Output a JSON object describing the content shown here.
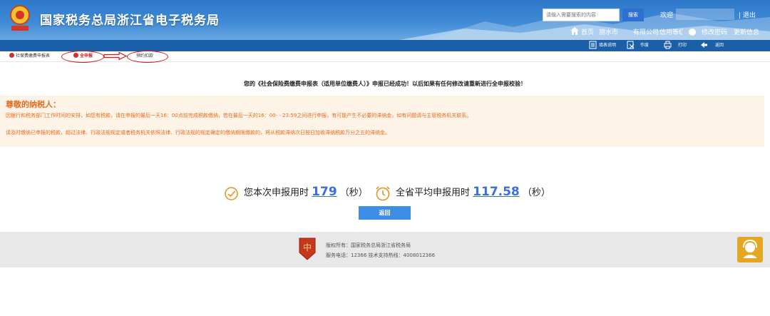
{
  "header": {
    "site_title": "国家税务总局浙江省电子税务局",
    "search_placeholder": "请输入需要搜索的内容",
    "search_button": "搜索",
    "welcome": "欢迎",
    "logout": "退出",
    "nav": {
      "home": "首页",
      "city": "丽水市",
      "company": "有限公司",
      "credit_level": "信用等级",
      "change_password": "修改密码",
      "more_info": "更新信息"
    },
    "separator": "|"
  },
  "toolbar": {
    "fill_instructions": "填表说明",
    "void": "作废",
    "print": "打印",
    "back": "返回"
  },
  "tabs": {
    "social_insurance_form": "社保费缴费申报表",
    "full_declaration": "全申报",
    "scheduled_deduction": "预约扣款"
  },
  "success_message": "您的《社会保险费缴费申报表（适用单位缴费人）》申报已经成功！以后如果有任何修改请重新进行全申报校验！",
  "notice": {
    "title": "尊敬的纳税人：",
    "line1": "因银行和税务部门工作时间的安排，如您有税款，请在申报的最后一天16：00点前完成税款缴纳，若在最后一天的16：00- - 23:59之间进行申报，有可能产生不必要的滞纳金，如有问题请与主管税务机关联系。",
    "line2": "请及时缴纳已申报的税款，超过法律、行政法规规定或者税务机关依照法律、行政法规的规定确定的缴纳期限缴款的，将从税款滞纳次日按日加收滞纳税款万分之五的滞纳金。"
  },
  "timing": {
    "this_label": "您本次申报用时",
    "this_value": "179",
    "this_unit": "（秒）",
    "avg_label": "全省平均申报用时",
    "avg_value": "117.58",
    "avg_unit": "（秒）"
  },
  "back_button": "返回",
  "footer": {
    "copyright": "版权所有：国家税务总局浙江省税务局",
    "hotline": "服务电话：12366 技术支持热线：4008012366"
  },
  "colors": {
    "header_blue": "#2d78c8",
    "toolbar_blue": "#1a5fa8",
    "notice_orange": "#e86a1c",
    "number_blue": "#3b6fe0",
    "annotation_red": "#d21a1a"
  }
}
